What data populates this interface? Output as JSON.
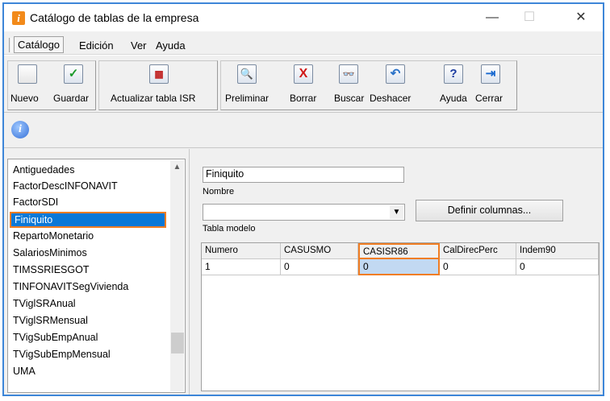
{
  "window": {
    "title": "Catálogo de tablas de la empresa",
    "minimize": "—",
    "maximize": "☐",
    "close": "✕"
  },
  "menu": {
    "items": [
      "Catálogo",
      "Edición",
      "Ver",
      "Ayuda"
    ]
  },
  "toolbar": {
    "nuevo": "Nuevo",
    "guardar": "Guardar",
    "actualizar": "Actualizar tabla ISR",
    "preliminar": "Preliminar",
    "borrar": "Borrar",
    "buscar": "Buscar",
    "deshacer": "Deshacer",
    "ayuda": "Ayuda",
    "cerrar": "Cerrar"
  },
  "list": {
    "items": [
      "Antiguedades",
      "FactorDescINFONAVIT",
      "FactorSDI",
      "Finiquito",
      "RepartoMonetario",
      "SalariosMinimos",
      "TIMSSRIESGOT",
      "TINFONAVITSegVivienda",
      "TViglSRAnual",
      "TViglSRMensual",
      "TVigSubEmpAnual",
      "TVigSubEmpMensual",
      "UMA"
    ],
    "selected_index": 3
  },
  "form": {
    "nombre_value": "Finiquito",
    "nombre_label": "Nombre",
    "tabla_modelo_value": "",
    "tabla_modelo_label": "Tabla modelo",
    "definir_label": "Definir columnas..."
  },
  "grid": {
    "headers": [
      "Numero",
      "CASUSMO",
      "CASISR86",
      "CalDirecPerc",
      "Indem90"
    ],
    "rows": [
      [
        "1",
        "0",
        "0",
        "0",
        "0"
      ]
    ],
    "highlighted_column": 2
  },
  "colors": {
    "accent": "#0a78d7",
    "highlight": "#f07d23",
    "frame": "#3d86d8"
  }
}
